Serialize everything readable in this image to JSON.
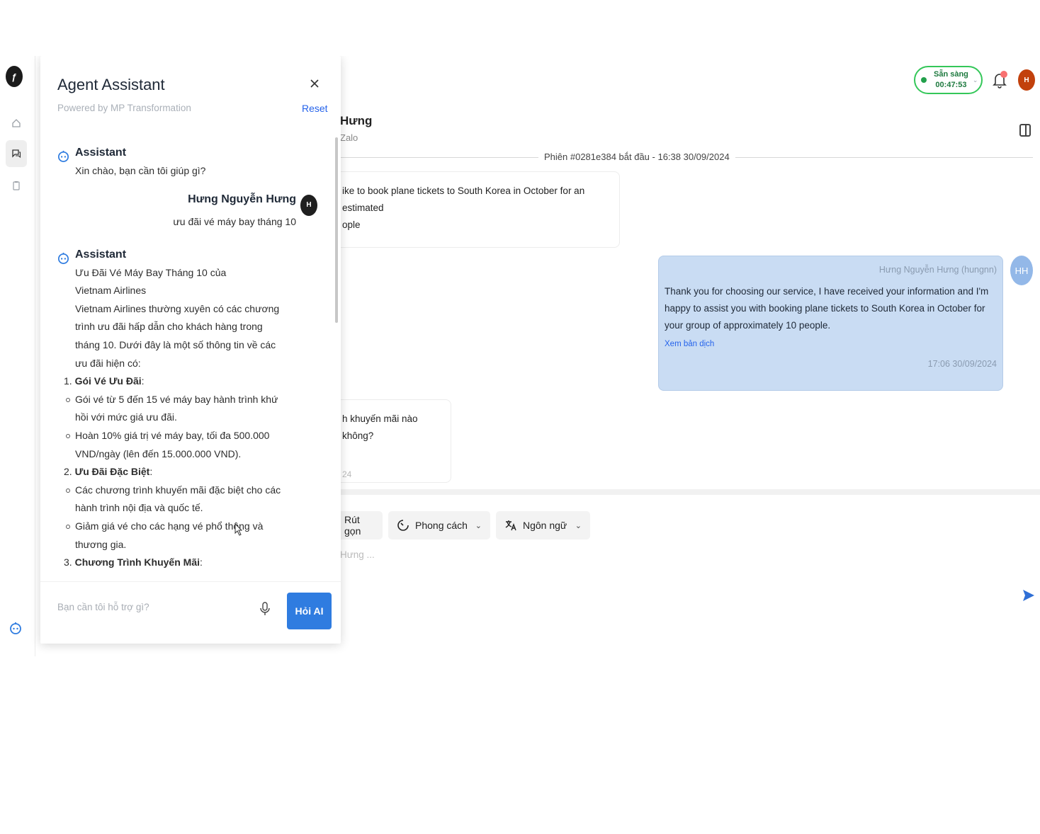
{
  "header": {
    "status_label": "Sẵn sàng",
    "status_timer": "00:47:53",
    "user_initial": "H"
  },
  "conversation": {
    "contact_name": "Hưng",
    "channel": "Zalo",
    "session_label": "Phiên #0281e384 bắt đầu - 16:38 30/09/2024",
    "incoming_1_line1": "ike to book plane tickets to South Korea in October for an estimated",
    "incoming_1_line2": "ople",
    "outgoing": {
      "sender": "Hưng Nguyễn Hưng (hungnn)",
      "avatar": "HH",
      "text": "Thank you for choosing our service, I have received your information and I'm happy to assist you with booking plane tickets to South Korea in October for your group of approximately 10 people.",
      "translate_link": "Xem bản dịch",
      "time": "17:06 30/09/2024"
    },
    "incoming_2_text": "h khuyến mãi nào không?",
    "incoming_2_time": "24"
  },
  "composer": {
    "shorten_label": "Rút gọn",
    "style_label": "Phong cách",
    "language_label": "Ngôn ngữ",
    "placeholder": "Hưng ..."
  },
  "assistant": {
    "title": "Agent Assistant",
    "powered_by": "Powered by MP Transformation",
    "reset_label": "Reset",
    "messages": {
      "greeting_sender": "Assistant",
      "greeting_text": "Xin chào, bạn cần tôi giúp gì?",
      "user_name": "Hưng Nguyễn Hưng",
      "user_initial": "H",
      "user_text": "ưu đãi vé máy bay tháng 10",
      "reply_sender": "Assistant",
      "reply_intro": "Ưu Đãi Vé Máy Bay Tháng 10 của Vietnam Airlines",
      "reply_body": "Vietnam Airlines thường xuyên có các chương trình ưu đãi hấp dẫn cho khách hàng trong tháng 10. Dưới đây là một số thông tin về các ưu đãi hiện có:",
      "section_1_num": "1.",
      "section_1_title": "Gói Vé Ưu Đãi",
      "section_1_bullet_1": "Gói vé từ 5 đến 15 vé máy bay hành trình khứ hồi với mức giá ưu đãi.",
      "section_1_bullet_2": "Hoàn 10% giá trị vé máy bay, tối đa 500.000 VND/ngày (lên đến 15.000.000 VND).",
      "section_2_num": "2.",
      "section_2_title": "Ưu Đãi Đặc Biệt",
      "section_2_bullet_1": "Các chương trình khuyến mãi đặc biệt cho các hành trình nội địa và quốc tế.",
      "section_2_bullet_2": "Giảm giá vé cho các hạng vé phổ thông và thương gia.",
      "section_3_num": "3.",
      "section_3_title": "Chương Trình Khuyến Mãi"
    },
    "input_placeholder": "Bạn cần tôi hỗ trợ gì?",
    "ask_button": "Hỏi AI"
  },
  "colors": {
    "accent": "#2f7ce0",
    "outgoing_bubble": "#c9dcf3",
    "status_green": "#34c759"
  },
  "icons": [
    "app-logo-icon",
    "home-icon",
    "chat-icon",
    "clipboard-icon",
    "bot-icon",
    "bell-icon",
    "panel-toggle-icon",
    "close-icon",
    "mic-icon",
    "send-icon",
    "style-icon",
    "translate-icon",
    "chevron-down-icon"
  ]
}
